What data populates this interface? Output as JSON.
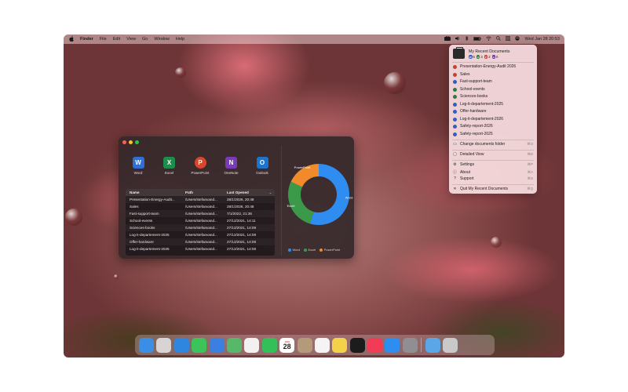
{
  "menubar": {
    "apple": "",
    "app_name": "Finder",
    "menus": [
      "File",
      "Edit",
      "View",
      "Go",
      "Window",
      "Help"
    ],
    "datetime": "Wed Jan 28  20:53"
  },
  "window": {
    "apps": [
      {
        "label": "Word",
        "icon": "word-icon",
        "color": "#2f6fd6",
        "letter": "W"
      },
      {
        "label": "Excel",
        "icon": "excel-icon",
        "color": "#1f8c4c",
        "letter": "X"
      },
      {
        "label": "PowerPoint",
        "icon": "powerpoint-icon",
        "color": "#d8472b",
        "letter": "P"
      },
      {
        "label": "OneNote",
        "icon": "onenote-icon",
        "color": "#7b3ab8",
        "letter": "N"
      },
      {
        "label": "Outlook",
        "icon": "outlook-icon",
        "color": "#1c74cf",
        "letter": "O"
      }
    ],
    "table": {
      "headers": [
        "Name",
        "Path",
        "Last Opened"
      ],
      "rows": [
        [
          "Presentation-Energy-Audit...",
          "/Users/stefanvand...",
          "28/1/2026, 20:48"
        ],
        [
          "Sales",
          "/Users/stefanvand...",
          "28/1/2026, 20:48"
        ],
        [
          "Fast-support-team",
          "/Users/stefanvand...",
          "7/1/2022, 21:36"
        ],
        [
          "School-events",
          "/Users/stefanvand...",
          "27/12/2021, 14:11"
        ],
        [
          "Sciences-books",
          "/Users/stefanvand...",
          "27/12/2021, 14:09"
        ],
        [
          "Log-it-departement-2025",
          "/Users/stefanvand...",
          "27/12/2021, 14:08"
        ],
        [
          "Offer-hardware",
          "/Users/stefanvand...",
          "27/12/2021, 14:08"
        ],
        [
          "Log-it-departement-2026",
          "/Users/stefanvand...",
          "27/12/2021, 14:08"
        ]
      ]
    }
  },
  "chart_data": {
    "type": "pie",
    "style": "donut",
    "series": [
      {
        "name": "Word",
        "value": 6,
        "color": "#2f8cf0"
      },
      {
        "name": "Excel",
        "value": 3,
        "color": "#3b9a4a"
      },
      {
        "name": "PowerPoint",
        "value": 2,
        "color": "#f08a2a"
      }
    ],
    "slice_labels": [
      "Word",
      "Excel",
      "PowerPoint"
    ],
    "legend": [
      "Word",
      "Excel",
      "PowerPoint"
    ],
    "legend_position": "bottom"
  },
  "menu": {
    "title": "My Recent Documents",
    "badges": [
      {
        "letter": "W",
        "count": "6",
        "color": "#2f5fc0"
      },
      {
        "letter": "X",
        "count": "3",
        "color": "#2f7a3a"
      },
      {
        "letter": "P",
        "count": "2",
        "color": "#c4432b"
      },
      {
        "letter": "O",
        "count": "0",
        "color": "#6a2fa0"
      }
    ],
    "documents": [
      {
        "label": "Presentation-Energy-Audit 2026",
        "color": "#c4432b"
      },
      {
        "label": "Sales",
        "color": "#c4432b"
      },
      {
        "label": "Fast-support-team",
        "color": "#2f5fc0"
      },
      {
        "label": "School-events",
        "color": "#2f7a3a"
      },
      {
        "label": "Sciences-books",
        "color": "#2f7a3a"
      },
      {
        "label": "Log-it-departement-2025",
        "color": "#2f5fc0"
      },
      {
        "label": "Offer-hardware",
        "color": "#2f5fc0"
      },
      {
        "label": "Log-it-departement-2026",
        "color": "#2f5fc0"
      },
      {
        "label": "Safety-report-2026",
        "color": "#2f5fc0"
      },
      {
        "label": "Safety-report-2025",
        "color": "#2f5fc0"
      }
    ],
    "actions": [
      {
        "label": "Change documents folder",
        "shortcut": "⌘O",
        "icon": "folder-icon"
      },
      {
        "label": "Detailed View",
        "shortcut": "⌘D",
        "icon": "window-icon"
      },
      {
        "label": "Settings",
        "shortcut": "⌘P",
        "icon": "gear-icon"
      },
      {
        "label": "About",
        "shortcut": "⌘A",
        "icon": "info-icon"
      },
      {
        "label": "Support",
        "shortcut": "⌘S",
        "icon": "question-icon"
      },
      {
        "label": "Quit My Recent Documents",
        "shortcut": "⌘Q",
        "icon": "close-icon"
      }
    ]
  },
  "calendar": {
    "month": "JAN",
    "day": "28"
  },
  "dock": [
    {
      "name": "finder-icon",
      "color": "#3a8ee6"
    },
    {
      "name": "launchpad-icon",
      "color": "#d9d4d4"
    },
    {
      "name": "safari-icon",
      "color": "#2e86de"
    },
    {
      "name": "messages-icon",
      "color": "#3cc45a"
    },
    {
      "name": "mail-icon",
      "color": "#3b7fe0"
    },
    {
      "name": "maps-icon",
      "color": "#58b86a"
    },
    {
      "name": "photos-icon",
      "color": "#f3f0f0"
    },
    {
      "name": "facetime-icon",
      "color": "#33c058"
    },
    {
      "name": "calendar-icon",
      "color": "#ffffff"
    },
    {
      "name": "contacts-icon",
      "color": "#b59a7a"
    },
    {
      "name": "reminders-icon",
      "color": "#f4f4f4"
    },
    {
      "name": "notes-icon",
      "color": "#f3d24a"
    },
    {
      "name": "appletv-icon",
      "color": "#1c1c1c"
    },
    {
      "name": "music-icon",
      "color": "#f23c56"
    },
    {
      "name": "appstore-icon",
      "color": "#2c8ef0"
    },
    {
      "name": "system-settings-icon",
      "color": "#8e8e93"
    },
    {
      "name": "separator",
      "color": ""
    },
    {
      "name": "downloads-folder-icon",
      "color": "#5aa6e6"
    },
    {
      "name": "trash-icon",
      "color": "#c9c9c9"
    }
  ]
}
